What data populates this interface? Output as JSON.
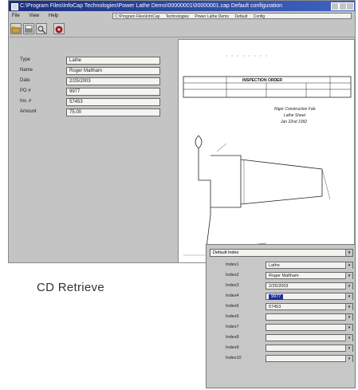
{
  "window": {
    "title": "C:\\Program Files\\InfoCap Technologies\\Power Lathe Demo\\00000001\\00000001.cap   Default configuration",
    "menu": [
      "File",
      "View",
      "Help"
    ],
    "path_segments": [
      "C:\\Program Files\\InfoCap",
      "Technologies",
      "Power Lathe Demo",
      "Default",
      "Config"
    ]
  },
  "fields": [
    {
      "label": "Type",
      "value": "Lathe"
    },
    {
      "label": "Name",
      "value": "Roger Maltham"
    },
    {
      "label": "Date",
      "value": "2/25/2003"
    },
    {
      "label": "PO #",
      "value": "9977"
    },
    {
      "label": "Inv. #",
      "value": "57453"
    },
    {
      "label": "Amount",
      "value": "75.00"
    }
  ],
  "drawing": {
    "header": "INSPECTION ORDER",
    "note_lines": [
      "Rigor Construction Fab.",
      "Lathe Sheet",
      "Jan 22nd 1992"
    ],
    "top_marks": "· · · · · · · ·"
  },
  "caption": "CD Retrieve",
  "index_panel": {
    "dropdown": "Default Index",
    "rows": [
      {
        "label": "Index1",
        "value": "Lathe",
        "selected": false
      },
      {
        "label": "Index2",
        "value": "Roger Maltham",
        "selected": false
      },
      {
        "label": "Index3",
        "value": "2/25/2003",
        "selected": false
      },
      {
        "label": "Index4",
        "value": "9977",
        "selected": true
      },
      {
        "label": "Index5",
        "value": "57453",
        "selected": false
      },
      {
        "label": "Index6",
        "value": "",
        "selected": false
      },
      {
        "label": "Index7",
        "value": "",
        "selected": false
      },
      {
        "label": "Index8",
        "value": "",
        "selected": false
      },
      {
        "label": "Index9",
        "value": "",
        "selected": false
      },
      {
        "label": "Index10",
        "value": "",
        "selected": false
      }
    ]
  },
  "colors": {
    "titlebar": "#1a2e7e",
    "selection": "#1f2f9a",
    "panel": "#c4c4c4"
  }
}
